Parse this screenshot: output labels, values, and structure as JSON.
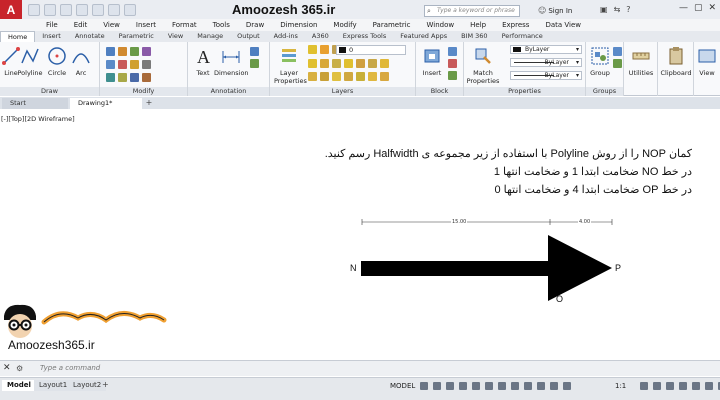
{
  "window": {
    "app_logo": "A",
    "title": "Amoozesh 365.ir",
    "search_placeholder": "Type a keyword or phrase",
    "sign_in": "Sign In",
    "controls": [
      "—",
      "▢",
      "✕"
    ]
  },
  "menu": [
    "File",
    "Edit",
    "View",
    "Insert",
    "Format",
    "Tools",
    "Draw",
    "Dimension",
    "Modify",
    "Parametric",
    "Window",
    "Help",
    "Express",
    "Data View"
  ],
  "ribbon_tabs": [
    "Home",
    "Insert",
    "Annotate",
    "Parametric",
    "View",
    "Manage",
    "Output",
    "Add-ins",
    "A360",
    "Express Tools",
    "Featured Apps",
    "BIM 360",
    "Performance"
  ],
  "ribbon": {
    "draw": {
      "label": "Draw",
      "tools": [
        "Line",
        "Polyline",
        "Circle",
        "Arc"
      ]
    },
    "modify": {
      "label": "Modify"
    },
    "annotation": {
      "label": "Annotation",
      "tools": [
        "Text",
        "Dimension"
      ]
    },
    "layers": {
      "label": "Layers",
      "layer_properties": "Layer Properties",
      "current_layer": "0"
    },
    "block": {
      "label": "Block",
      "insert": "Insert"
    },
    "properties": {
      "label": "Properties",
      "match": "Match Properties",
      "color": "ByLayer",
      "linetype": "ByLayer",
      "lineweight": "ByLayer"
    },
    "groups": {
      "label": "Groups",
      "group": "Group"
    },
    "utilities": "Utilities",
    "clipboard": "Clipboard",
    "view": "View"
  },
  "file_tabs": [
    "Start",
    "Drawing1*"
  ],
  "file_tab_add": "+",
  "viewport_label": "[-][Top][2D Wireframe]",
  "instructions": [
    "کمان NOP را از روش Polyline با استفاده از زیر مجموعه ی Halfwidth رسم کنید.",
    "در خط NO ضخامت ابتدا 1 و ضخامت انتها 1",
    "در خط OP ضخامت ابتدا 4 و ضخامت انتها 0"
  ],
  "dimensions": {
    "first": "15.00",
    "second": "4.00"
  },
  "points": {
    "n": "N",
    "o": "O",
    "p": "P"
  },
  "watermark": {
    "site": "Amoozesh365.ir"
  },
  "command_line": {
    "placeholder": "Type a command",
    "close": "✕"
  },
  "status": {
    "layouts": [
      "Model",
      "Layout1",
      "Layout2"
    ],
    "model": "MODEL",
    "scale": "1:1"
  },
  "colors": {
    "accent": "#c8242b",
    "arrow": "#000000",
    "logo_orange": "#f0a032"
  }
}
